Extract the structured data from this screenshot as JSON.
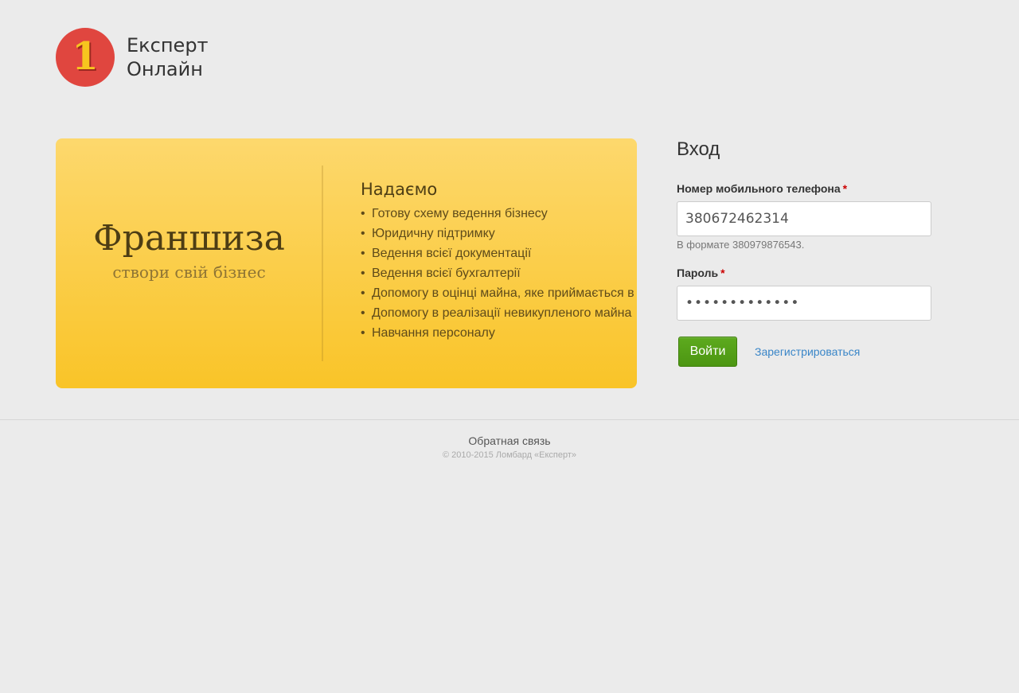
{
  "logo": {
    "badge_digit": "1",
    "line1": "Експерт",
    "line2": "Онлайн"
  },
  "banner": {
    "title": "Франшиза",
    "subtitle": "створи свій бізнес",
    "heading": "Надаємо",
    "items": [
      "Готову схему ведення бізнесу",
      "Юридичну підтримку",
      "Ведення всієї документації",
      "Ведення всієї бухгалтерії",
      "Допомогу в оцінці майна, яке приймається в",
      "Допомогу в реалізації невикупленого майна",
      "Навчання персоналу"
    ]
  },
  "login": {
    "title": "Вход",
    "phone_label": "Номер мобильного телефона",
    "phone_value": "380672462314",
    "phone_hint": "В формате 380979876543.",
    "password_label": "Пароль",
    "password_value": "•••••••••••••",
    "required_mark": "*",
    "submit_label": "Войти",
    "register_label": "Зарегистрироваться"
  },
  "footer": {
    "feedback_label": "Обратная связь",
    "copyright": "© 2010-2015 Ломбард «Експерт»"
  },
  "colors": {
    "accent_green": "#55a017",
    "link_blue": "#3a86c8",
    "logo_red": "#e0463f",
    "banner_yellow": "#f9c428"
  }
}
